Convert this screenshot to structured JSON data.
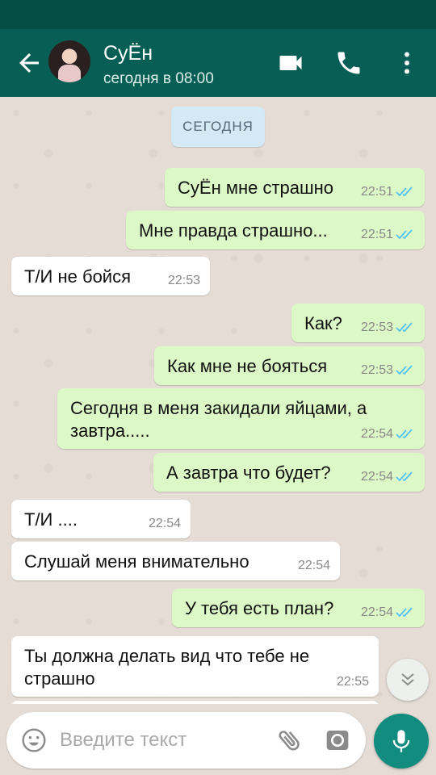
{
  "header": {
    "contact_name": "СуЁн",
    "contact_status": "сегодня в 08:00"
  },
  "chat": {
    "date_label": "СЕГОДНЯ",
    "messages": [
      {
        "direction": "out",
        "text": "СуЁн мне страшно",
        "time": "22:51",
        "read": true
      },
      {
        "direction": "out",
        "text": "Мне правда страшно...",
        "time": "22:51",
        "read": true
      },
      {
        "direction": "in",
        "text": "Т/И не бойся",
        "time": "22:53"
      },
      {
        "direction": "out",
        "text": "Как?",
        "time": "22:53",
        "read": true
      },
      {
        "direction": "out",
        "text": "Как мне не бояться",
        "time": "22:53",
        "read": true
      },
      {
        "direction": "out",
        "text": "Сегодня в меня закидали яйцами, а\nзавтра.....",
        "time": "22:54",
        "read": true
      },
      {
        "direction": "out",
        "text": "А завтра что будет?",
        "time": "22:54",
        "read": true
      },
      {
        "direction": "in",
        "text": "Т/И ....",
        "time": "22:54"
      },
      {
        "direction": "in",
        "text": "Слушай меня внимательно",
        "time": "22:54"
      },
      {
        "direction": "out",
        "text": "У тебя есть план?",
        "time": "22:54",
        "read": true
      },
      {
        "direction": "in",
        "text": "Ты должна делать вид что тебе не\nстрашно",
        "time": "22:55"
      }
    ]
  },
  "composer": {
    "placeholder": "Введите текст"
  },
  "colors": {
    "header": "#075e54",
    "status_bar": "#054d44",
    "outgoing_bubble": "#dcf8c6",
    "incoming_bubble": "#ffffff",
    "read_ticks": "#4fc3f7",
    "mic_button": "#128c7e"
  },
  "icons": {
    "back": "arrow-left-icon",
    "video": "video-camera-icon",
    "call": "phone-icon",
    "menu": "more-vertical-icon",
    "scroll": "chevron-double-down-icon",
    "emoji": "emoji-icon",
    "attach": "paperclip-icon",
    "camera": "camera-icon",
    "mic": "microphone-icon"
  }
}
